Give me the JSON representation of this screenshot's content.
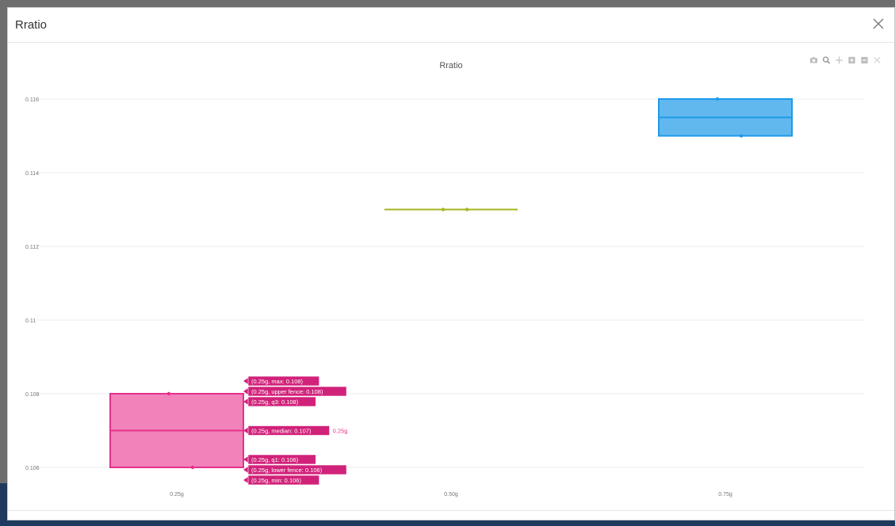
{
  "modal": {
    "title": "Rratio"
  },
  "modebar": {
    "icons": [
      "camera-icon",
      "zoom-icon",
      "pan-icon",
      "zoom-in-icon",
      "zoom-out-icon",
      "reset-axes-icon"
    ]
  },
  "colors": {
    "series_0_25g": "#e8308c",
    "series_0_50g": "#a6b61e",
    "series_0_75g": "#1e9ae8",
    "hover_label_bg": "#d1227a"
  },
  "chart_data": {
    "type": "box",
    "title": "Rratio",
    "xlabel": "",
    "ylabel": "",
    "categories": [
      "0.25g",
      "0.50g",
      "0.75g"
    ],
    "ylim": [
      0.1055,
      0.1163
    ],
    "yticks": [
      "0.106",
      "0.108",
      "0.11",
      "0.112",
      "0.114",
      "0.116"
    ],
    "grid": true,
    "series": [
      {
        "x": "0.25g",
        "min": 0.106,
        "lower_fence": 0.106,
        "q1": 0.106,
        "median": 0.107,
        "q3": 0.108,
        "upper_fence": 0.108,
        "max": 0.108,
        "points": [
          0.108,
          0.106
        ]
      },
      {
        "x": "0.50g",
        "min": 0.113,
        "lower_fence": 0.113,
        "q1": 0.113,
        "median": 0.113,
        "q3": 0.113,
        "upper_fence": 0.113,
        "max": 0.113,
        "points": [
          0.113,
          0.113
        ]
      },
      {
        "x": "0.75g",
        "min": 0.115,
        "lower_fence": 0.115,
        "q1": 0.115,
        "median": 0.1155,
        "q3": 0.116,
        "upper_fence": 0.116,
        "max": 0.116,
        "points": [
          0.116,
          0.115
        ]
      }
    ],
    "hover": {
      "category": "0.25g",
      "labels": [
        {
          "key": "max",
          "text": "(0.25g, max: 0.108)"
        },
        {
          "key": "upper_fence",
          "text": "(0.25g, upper fence: 0.108)"
        },
        {
          "key": "q3",
          "text": "(0.25g, q3: 0.108)"
        },
        {
          "key": "median",
          "text": "(0.25g, median: 0.107)"
        },
        {
          "key": "q1",
          "text": "(0.25g, q1: 0.106)"
        },
        {
          "key": "lower_fence",
          "text": "(0.25g, lower fence: 0.106)"
        },
        {
          "key": "min",
          "text": "(0.25g, min: 0.106)"
        }
      ],
      "trace_label": "0.25g"
    }
  }
}
